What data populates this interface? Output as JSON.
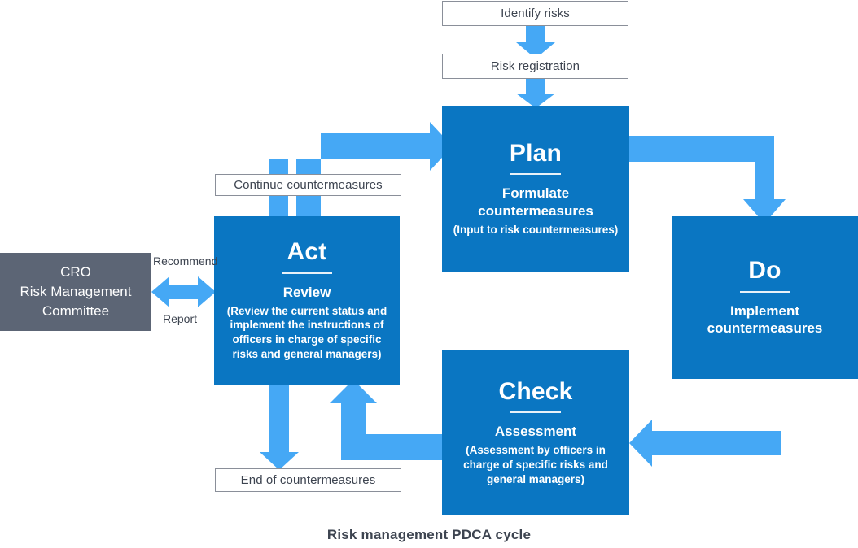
{
  "caption": "Risk management PDCA cycle",
  "colors": {
    "panel_blue": "#0a76c2",
    "arrow_blue": "#45a8f5",
    "committee_gray": "#5c6575",
    "label_border": "#8a8f99",
    "text_dark": "#3d4450",
    "background": "#ffffff"
  },
  "entry_steps": [
    {
      "label": "Identify risks"
    },
    {
      "label": "Risk registration"
    }
  ],
  "cycle": {
    "plan": {
      "title": "Plan",
      "subtitle": "Formulate\ncountermeasures",
      "note": "(Input to risk countermeasures)"
    },
    "do": {
      "title": "Do",
      "subtitle": "Implement\ncountermeasures",
      "note": ""
    },
    "check": {
      "title": "Check",
      "subtitle": "Assessment",
      "note": "(Assessment by officers in charge of specific risks and general managers)"
    },
    "act": {
      "title": "Act",
      "subtitle": "Review",
      "note": "(Review the current status and implement the instructions of officers in charge of specific risks and general managers)"
    }
  },
  "committee": {
    "line1": "CRO",
    "line2": "Risk Management",
    "line3": "Committee"
  },
  "connector_labels": {
    "recommend": "Recommend",
    "report": "Report"
  },
  "branch_labels": {
    "continue": "Continue countermeasures",
    "end": "End of countermeasures"
  }
}
